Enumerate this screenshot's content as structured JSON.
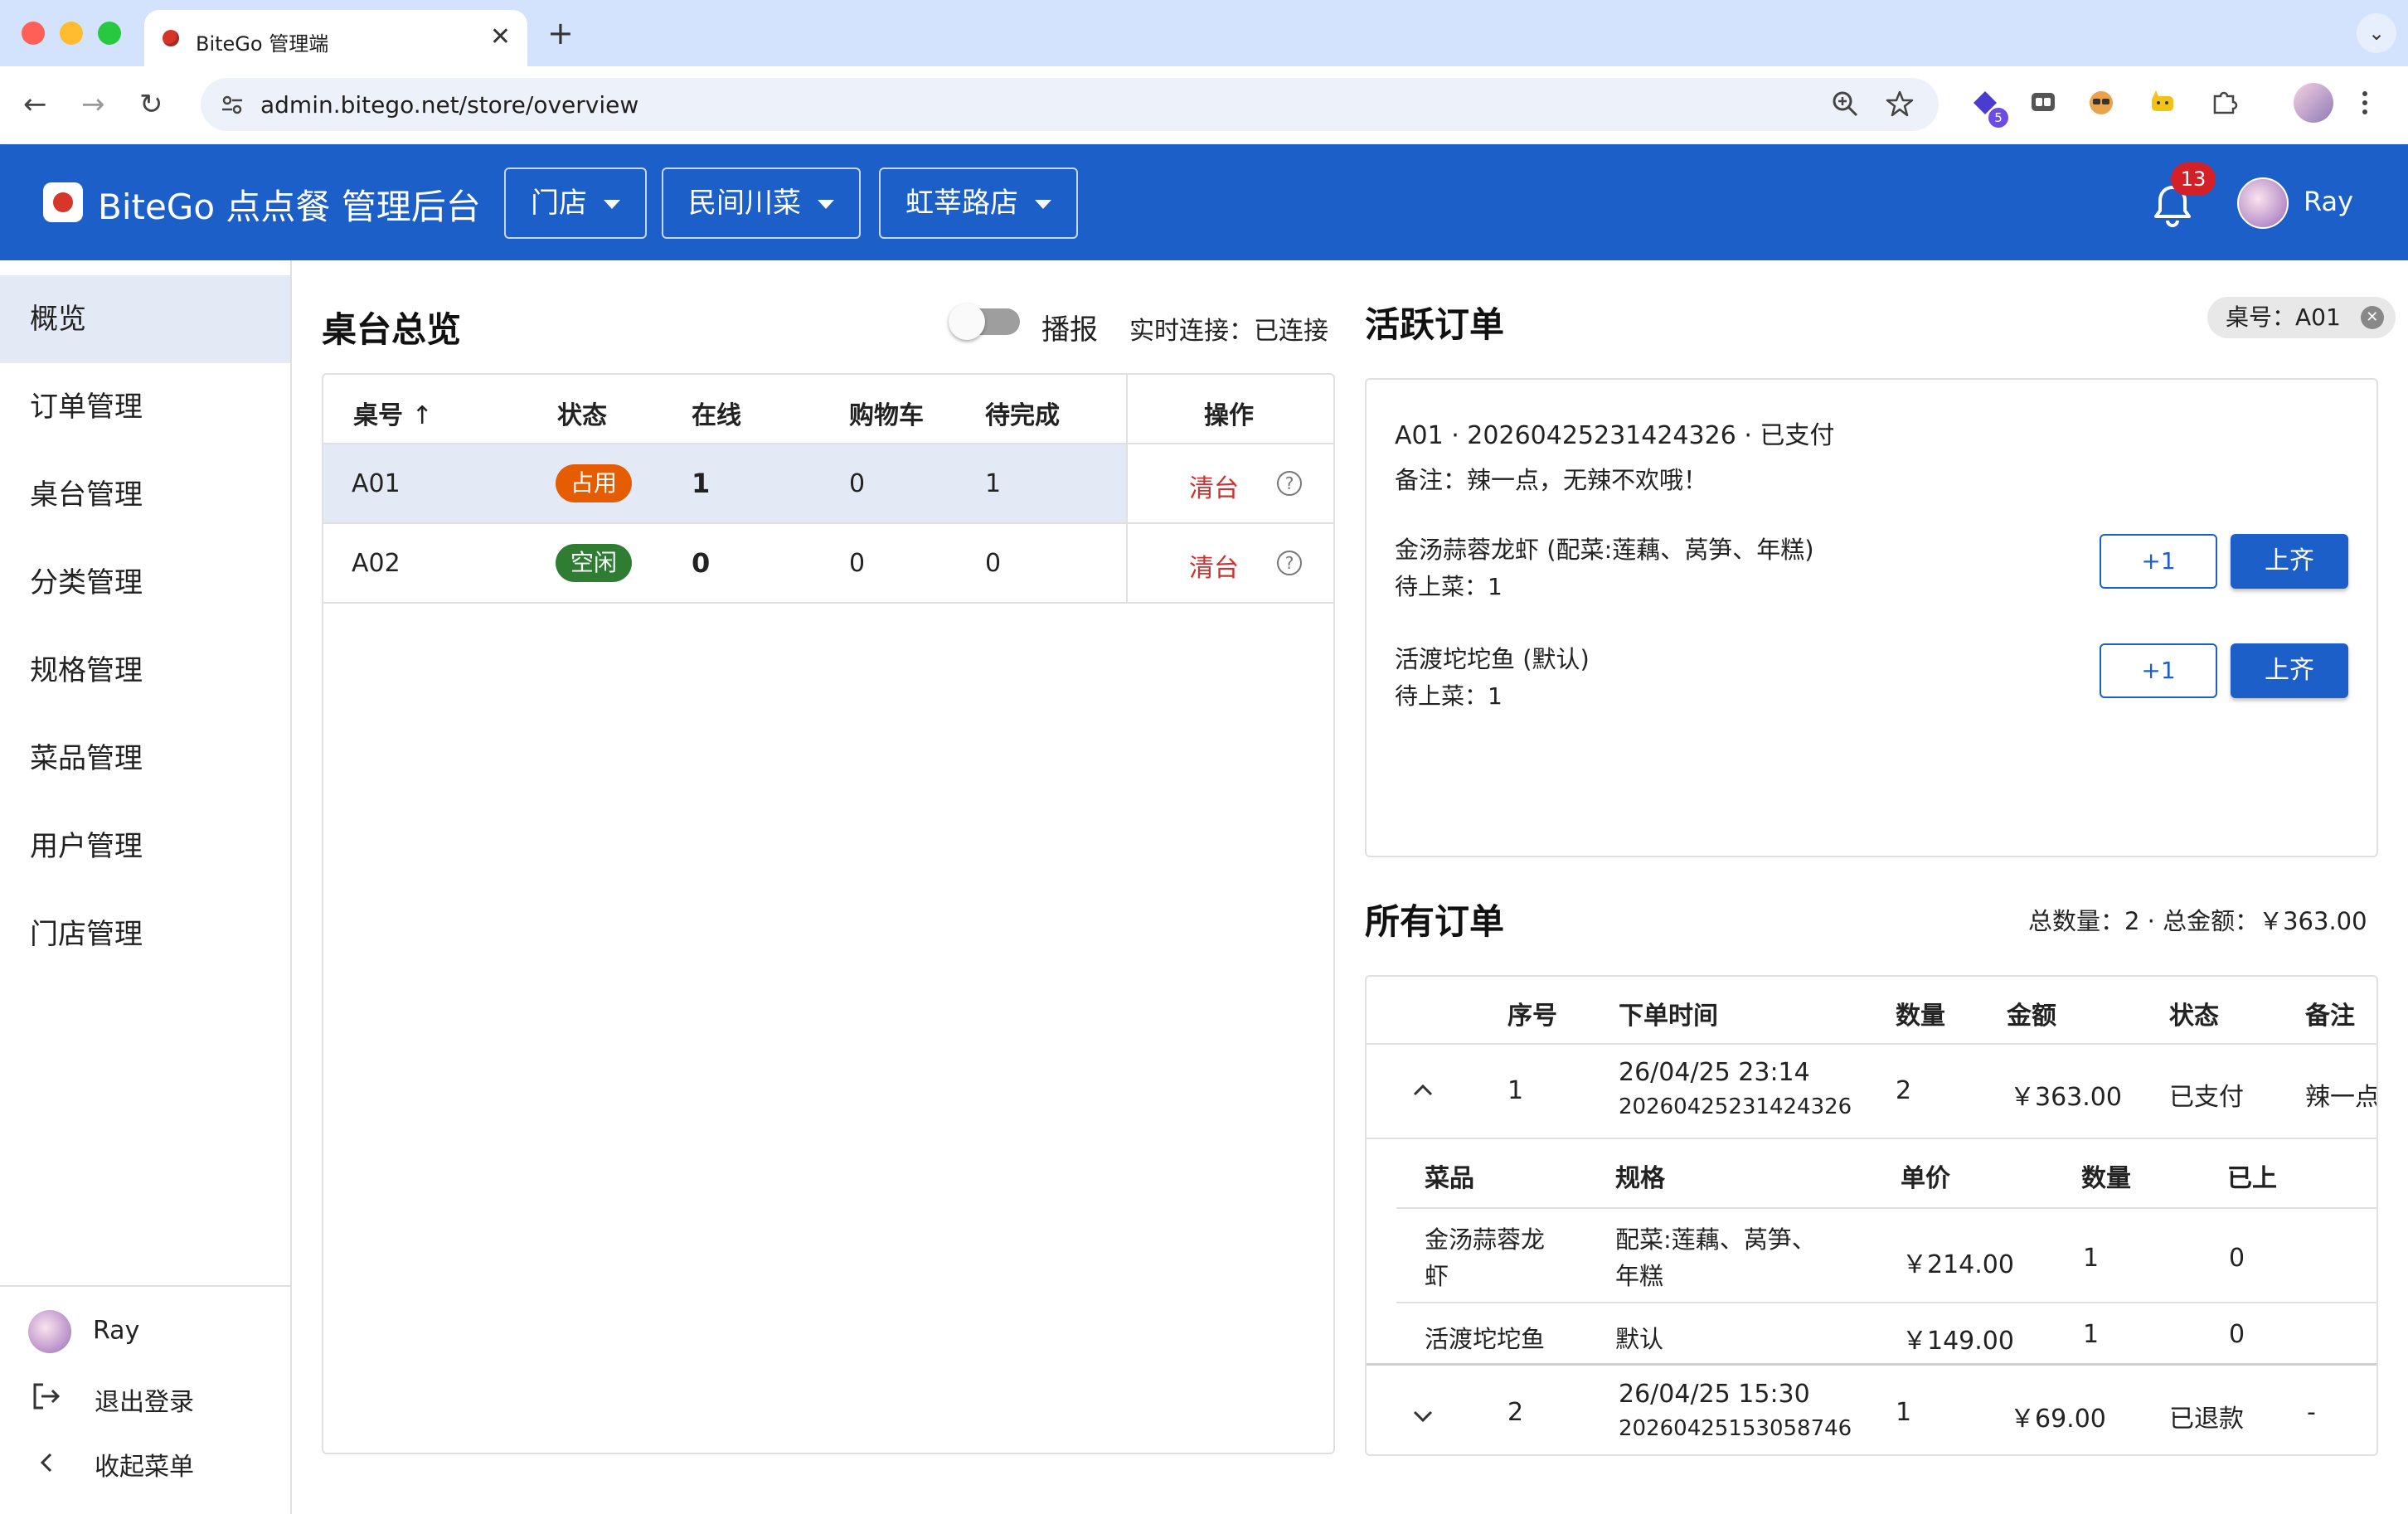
{
  "browser": {
    "tab_title": "BiteGo 管理端",
    "url": "admin.bitego.net/store/overview",
    "ext_badge": "5",
    "nav": {
      "back": "←",
      "forward": "→",
      "reload": "↻"
    },
    "close_glyph": "✕",
    "newtab_glyph": "+",
    "dropdown_glyph": "⌄"
  },
  "header": {
    "title": "BiteGo 点点餐 管理后台",
    "selectors": [
      "门店",
      "民间川菜",
      "虹莘路店"
    ],
    "notification_count": "13",
    "user": "Ray"
  },
  "sidebar": {
    "items": [
      {
        "label": "概览",
        "active": true
      },
      {
        "label": "订单管理"
      },
      {
        "label": "桌台管理"
      },
      {
        "label": "分类管理"
      },
      {
        "label": "规格管理"
      },
      {
        "label": "菜品管理"
      },
      {
        "label": "用户管理"
      },
      {
        "label": "门店管理"
      }
    ],
    "footer": {
      "user": "Ray",
      "logout": "退出登录",
      "collapse": "收起菜单"
    }
  },
  "tables_overview": {
    "title": "桌台总览",
    "broadcast_label": "播报",
    "broadcast_on": false,
    "connection": "实时连接：已连接",
    "columns": [
      "桌号",
      "状态",
      "在线",
      "购物车",
      "待完成",
      "操作"
    ],
    "sort_glyph": "↑",
    "rows": [
      {
        "table": "A01",
        "status": "占用",
        "online": "1",
        "cart": "0",
        "pending": "1",
        "action": "清台",
        "help": "?"
      },
      {
        "table": "A02",
        "status": "空闲",
        "online": "0",
        "cart": "0",
        "pending": "0",
        "action": "清台",
        "help": "?"
      }
    ]
  },
  "active_orders": {
    "title": "活跃订单",
    "filter_chip": "桌号：A01",
    "filter_clear": "✕",
    "order_header": "A01 · 20260425231424326 · 已支付",
    "note": "备注：辣一点，无辣不欢哦！",
    "items": [
      {
        "name": "金汤蒜蓉龙虾 (配菜:莲藕、莴笋、年糕)",
        "pending": "待上菜：1",
        "plus": "+1",
        "serve": "上齐"
      },
      {
        "name": "活渡坨坨鱼 (默认)",
        "pending": "待上菜：1",
        "plus": "+1",
        "serve": "上齐"
      }
    ]
  },
  "all_orders": {
    "title": "所有订单",
    "summary": "总数量：2 · 总金额：￥363.00",
    "columns": [
      "序号",
      "下单时间",
      "数量",
      "金额",
      "状态",
      "备注"
    ],
    "rows": [
      {
        "seq": "1",
        "time": "26/04/25 23:14",
        "order_no": "20260425231424326",
        "qty": "2",
        "amount": "￥363.00",
        "status": "已支付",
        "note": "辣一点",
        "expanded": true,
        "chevron": "^"
      },
      {
        "seq": "2",
        "time": "26/04/25 15:30",
        "order_no": "20260425153058746",
        "qty": "1",
        "amount": "￥69.00",
        "status": "已退款",
        "note": "-",
        "expanded": false,
        "chevron": "⌄"
      }
    ],
    "detail_columns": [
      "菜品",
      "规格",
      "单价",
      "数量",
      "已上"
    ],
    "detail_rows": [
      {
        "dish_line1": "金汤蒜蓉龙",
        "dish_line2": "虾",
        "spec_line1": "配菜:莲藕、莴笋、",
        "spec_line2": "年糕",
        "price": "￥214.00",
        "qty": "1",
        "served": "0"
      },
      {
        "dish_line1": "活渡坨坨鱼",
        "dish_line2": "",
        "spec_line1": "默认",
        "spec_line2": "",
        "price": "￥149.00",
        "qty": "1",
        "served": "0"
      }
    ]
  },
  "colors": {
    "primary": "#1c5fc8",
    "busy": "#e65c00",
    "idle": "#2e7d32",
    "danger": "#d32f2f",
    "badge": "#d42027"
  }
}
